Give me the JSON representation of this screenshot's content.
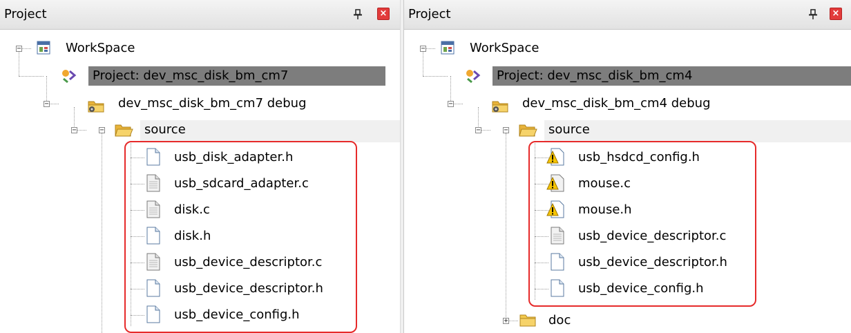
{
  "left": {
    "title": "Project",
    "workspace": "WorkSpace",
    "project": "Project: dev_msc_disk_bm_cm7",
    "target": "dev_msc_disk_bm_cm7 debug",
    "folder": "source",
    "files": [
      {
        "name": "usb_disk_adapter.h",
        "icon": "header-file-icon"
      },
      {
        "name": "usb_sdcard_adapter.c",
        "icon": "source-file-icon"
      },
      {
        "name": "disk.c",
        "icon": "source-file-icon"
      },
      {
        "name": "disk.h",
        "icon": "header-file-icon"
      },
      {
        "name": "usb_device_descriptor.c",
        "icon": "source-file-icon"
      },
      {
        "name": "usb_device_descriptor.h",
        "icon": "header-file-icon"
      },
      {
        "name": "usb_device_config.h",
        "icon": "header-file-icon"
      }
    ]
  },
  "right": {
    "title": "Project",
    "workspace": "WorkSpace",
    "project": "Project: dev_msc_disk_bm_cm4",
    "target": "dev_msc_disk_bm_cm4 debug",
    "folder": "source",
    "files": [
      {
        "name": "usb_hsdcd_config.h",
        "icon": "warning-file-icon"
      },
      {
        "name": "mouse.c",
        "icon": "warning-file-icon"
      },
      {
        "name": "mouse.h",
        "icon": "warning-file-icon"
      },
      {
        "name": "usb_device_descriptor.c",
        "icon": "source-file-icon"
      },
      {
        "name": "usb_device_descriptor.h",
        "icon": "header-file-icon"
      },
      {
        "name": "usb_device_config.h",
        "icon": "header-file-icon"
      }
    ],
    "extra_folder": "doc"
  },
  "colors": {
    "selection": "#7d7d7d",
    "highlight_box": "#e62a2a",
    "close_button": "#e23b3b",
    "folder": "#f2c94c",
    "warning": "#f5c400"
  }
}
